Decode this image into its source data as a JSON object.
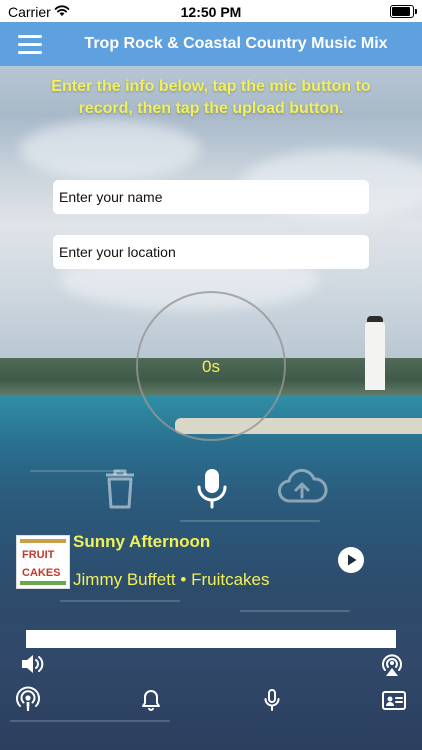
{
  "status_bar": {
    "carrier": "Carrier",
    "time": "12:50 PM"
  },
  "nav": {
    "title": "Trop Rock & Coastal Country Music Mix",
    "menu_icon": "hamburger-menu-icon"
  },
  "instructions": "Enter the info below, tap the mic button to record, then tap the upload button.",
  "form": {
    "name_placeholder": "Enter your name",
    "location_placeholder": "Enter your location",
    "name_value": "",
    "location_value": ""
  },
  "recorder": {
    "timer": "0s",
    "actions": [
      "trash-icon",
      "microphone-icon",
      "cloud-upload-icon"
    ]
  },
  "now_playing": {
    "title": "Sunny Afternoon",
    "artist": "Jimmy Buffett",
    "separator": "•",
    "album": "Fruitcakes",
    "progress": 0.0
  },
  "controls": {
    "left_icon": "speaker-icon",
    "right_icon": "airplay-icon"
  },
  "tabs": [
    "podcast-icon",
    "bell-icon",
    "microphone-icon",
    "contact-card-icon"
  ],
  "colors": {
    "nav_bar": "#5fa1de",
    "accent_text": "#f2f057",
    "icon_white": "#ffffff"
  }
}
